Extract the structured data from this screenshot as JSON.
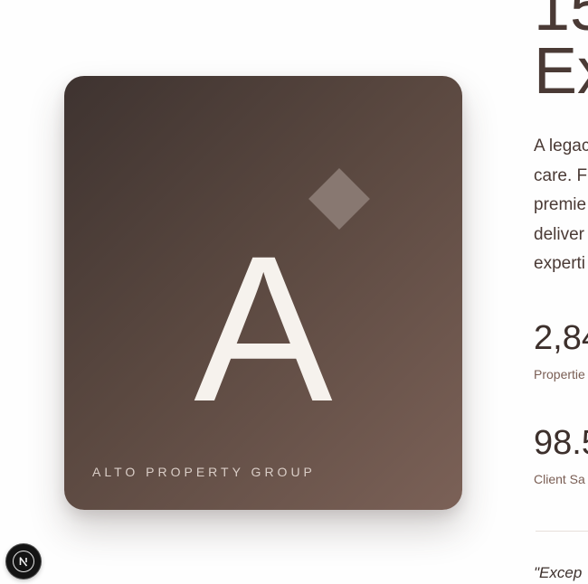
{
  "brand": {
    "letter": "A",
    "name": "ALTO PROPERTY GROUP"
  },
  "hero": {
    "title_line1": "15",
    "title_line2": "Ex"
  },
  "description": {
    "lines": [
      "A legac",
      "care. F",
      "premie",
      "deliver",
      "experti"
    ]
  },
  "stats": [
    {
      "value": "2,84",
      "label": "Propertie"
    },
    {
      "value": "98.5",
      "label": "Client Sa"
    }
  ],
  "quote": "\"Excep",
  "dev_indicator": {
    "icon": "nextjs-logo-icon"
  },
  "colors": {
    "card_dark": "#3e3330",
    "card_light": "#7b6157",
    "text_primary": "#4a3a35",
    "text_accent": "#7a5e54"
  }
}
